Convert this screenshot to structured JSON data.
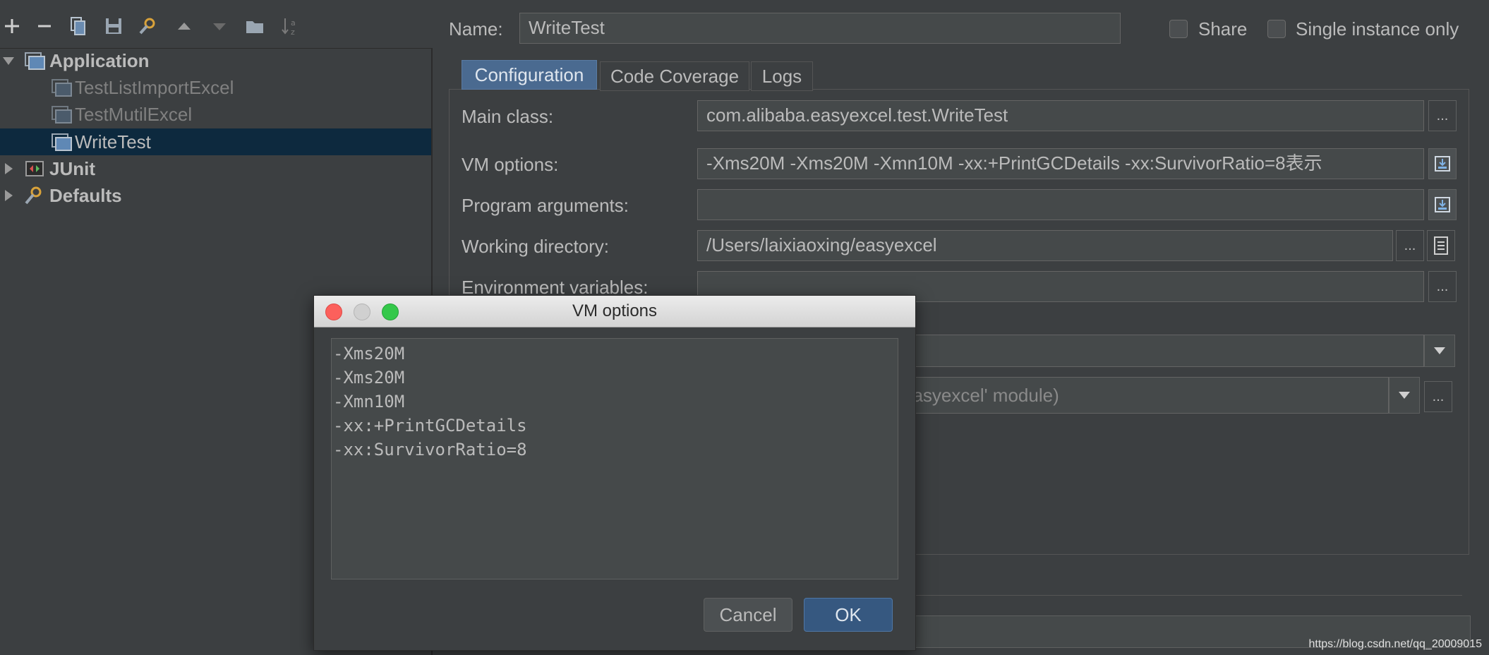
{
  "toolbar": {
    "icons": [
      "add-icon",
      "remove-icon",
      "copy-icon",
      "save-icon",
      "edit-defaults-icon",
      "move-up-icon",
      "move-down-icon",
      "folder-icon",
      "sort-icon"
    ]
  },
  "tree": {
    "application": "Application",
    "items": [
      "TestListImportExcel",
      "TestMutilExcel",
      "WriteTest"
    ],
    "junit": "JUnit",
    "defaults": "Defaults"
  },
  "header": {
    "name_label": "Name:",
    "name_value": "WriteTest",
    "share_label": "Share",
    "single_instance_label": "Single instance only"
  },
  "tabs": [
    "Configuration",
    "Code Coverage",
    "Logs"
  ],
  "form": {
    "main_class_label": "Main class:",
    "main_class_value": "com.alibaba.easyexcel.test.WriteTest",
    "vm_options_label": "VM options:",
    "vm_options_value": "-Xms20M -Xms20M -Xmn10M -xx:+PrintGCDetails -xx:SurvivorRatio=8表示",
    "program_args_label": "Program arguments:",
    "program_args_value": "",
    "working_dir_label": "Working directory:",
    "working_dir_value": "/Users/laixiaoxing/easyexcel",
    "env_vars_label": "Environment variables:",
    "module_value_partial": "easyexcel' module)",
    "ellipsis": "..."
  },
  "dialog": {
    "title": "VM options",
    "lines": [
      "-Xms20M",
      "-Xms20M",
      "-Xmn10M",
      "-xx:+PrintGCDetails",
      "-xx:SurvivorRatio=8"
    ],
    "cancel_label": "Cancel",
    "ok_label": "OK"
  },
  "watermark": "https://blog.csdn.net/qq_20009015",
  "colors": {
    "background": "#3c3f41",
    "field": "#45494a",
    "selection": "#0d293e",
    "accent_tab": "#4a6a90",
    "ok_button": "#365880"
  }
}
